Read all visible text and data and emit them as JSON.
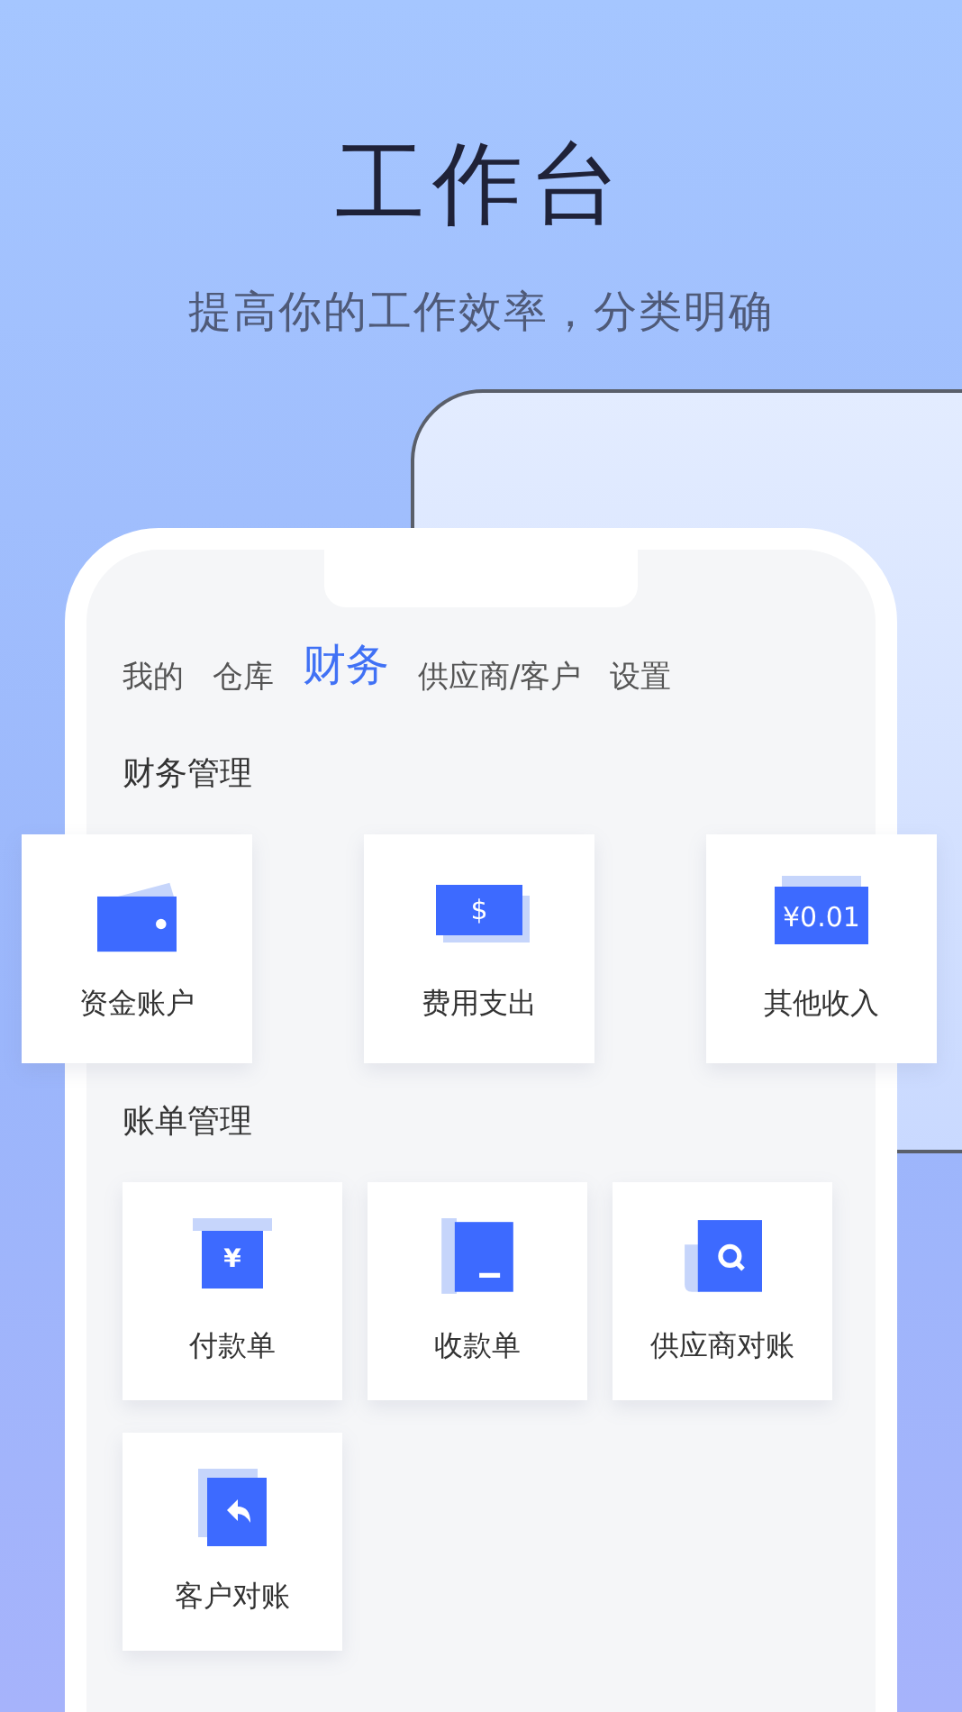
{
  "headline": "工作台",
  "subtitle": "提高你的工作效率，分类明确",
  "tabs": [
    {
      "label": "我的",
      "selected": false
    },
    {
      "label": "仓库",
      "selected": false
    },
    {
      "label": "财务",
      "selected": true
    },
    {
      "label": "供应商/客户",
      "selected": false
    },
    {
      "label": "设置",
      "selected": false
    }
  ],
  "sections": [
    {
      "title": "财务管理",
      "items": [
        {
          "label": "资金账户",
          "kind": "wallet"
        },
        {
          "label": "费用支出",
          "kind": "bill",
          "icon_text": "$"
        },
        {
          "label": "其他收入",
          "kind": "money",
          "icon_text": "¥0.01"
        }
      ]
    },
    {
      "title": "账单管理",
      "items": [
        {
          "label": "付款单",
          "kind": "receipt",
          "icon_text": "¥"
        },
        {
          "label": "收款单",
          "kind": "document"
        },
        {
          "label": "供应商对账",
          "kind": "search"
        },
        {
          "label": "客户对账",
          "kind": "reply"
        }
      ]
    }
  ]
}
